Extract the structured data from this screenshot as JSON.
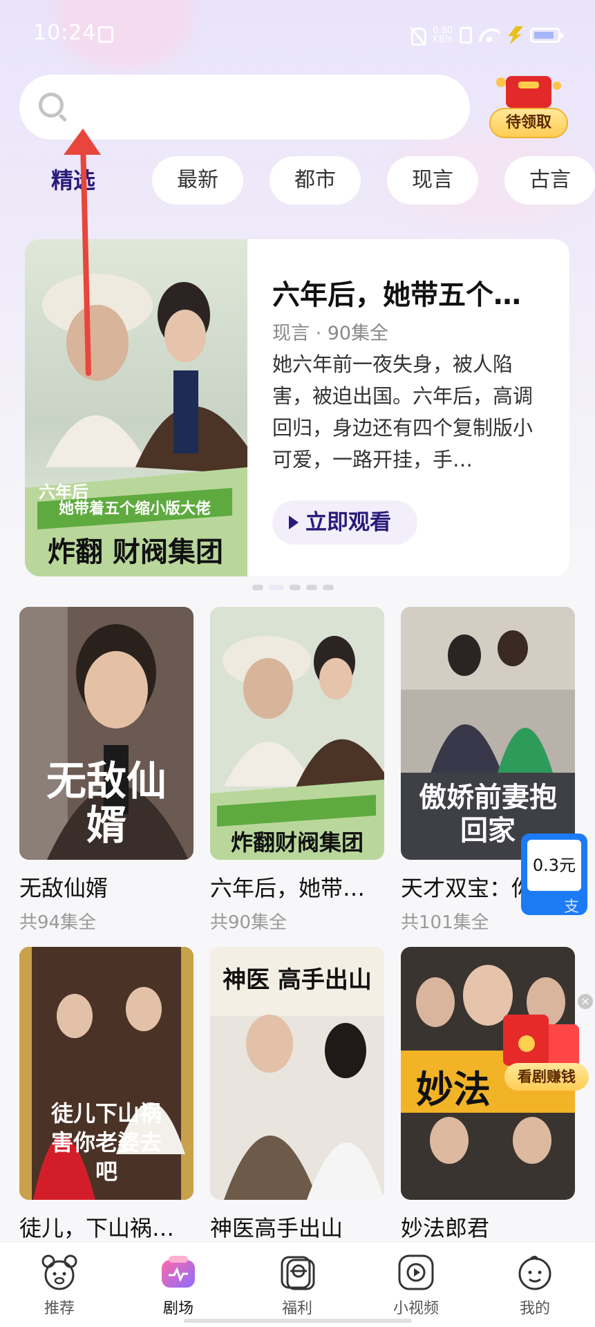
{
  "status_bar": {
    "time": "10:24",
    "net_speed": "0.80",
    "net_unit": "KB/s"
  },
  "header": {
    "search_placeholder": "",
    "reward_label": "待领取"
  },
  "tabs": [
    {
      "label": "精选",
      "active": true
    },
    {
      "label": "最新",
      "active": false
    },
    {
      "label": "都市",
      "active": false
    },
    {
      "label": "现言",
      "active": false
    },
    {
      "label": "古言",
      "active": false
    }
  ],
  "hero": {
    "title": "六年后，她带五个…",
    "meta": "现言 · 90集全",
    "description": "她六年前一夜失身，被人陷害，被迫出国。六年后，高调回归，身边还有四个复制版小可爱，一路开挂，手…",
    "watch_label": "立即观看",
    "poster_lines": [
      "六年后",
      "她带着五个缩小版大佬",
      "炸翻 财阀集团"
    ]
  },
  "carousel": {
    "count": 5,
    "active": 1
  },
  "dramas": [
    {
      "name": "无敌仙婿",
      "count": "共94集全",
      "poster_text": "无敌仙婿"
    },
    {
      "name": "六年后，她带…",
      "count": "共90集全",
      "poster_text": "炸翻财阀集团"
    },
    {
      "name": "天才双宝：你",
      "count": "共101集全",
      "poster_text": "傲娇前妻抱回家"
    },
    {
      "name": "徒儿，下山祸…",
      "count": "",
      "poster_text": "徒儿下山祸害你老婆去吧"
    },
    {
      "name": "神医高手出山",
      "count": "",
      "poster_text": "神医 高手出山"
    },
    {
      "name": "妙法郎君",
      "count": "",
      "poster_text": "妙法"
    }
  ],
  "floating": {
    "price": "0.3元",
    "pay_glyph": "支",
    "earn_label": "看剧赚钱",
    "close_glyph": "×"
  },
  "bottom_nav": [
    {
      "label": "推荐",
      "icon": "bear-face-icon"
    },
    {
      "label": "剧场",
      "icon": "theater-icon"
    },
    {
      "label": "福利",
      "icon": "gift-icon"
    },
    {
      "label": "小视频",
      "icon": "video-play-icon"
    },
    {
      "label": "我的",
      "icon": "smile-face-icon"
    }
  ],
  "colors": {
    "accent": "#2a1a7a",
    "reward_yellow": "#ffcd54",
    "price_blue": "#1c7af5",
    "arrow_red": "#e8463c"
  }
}
